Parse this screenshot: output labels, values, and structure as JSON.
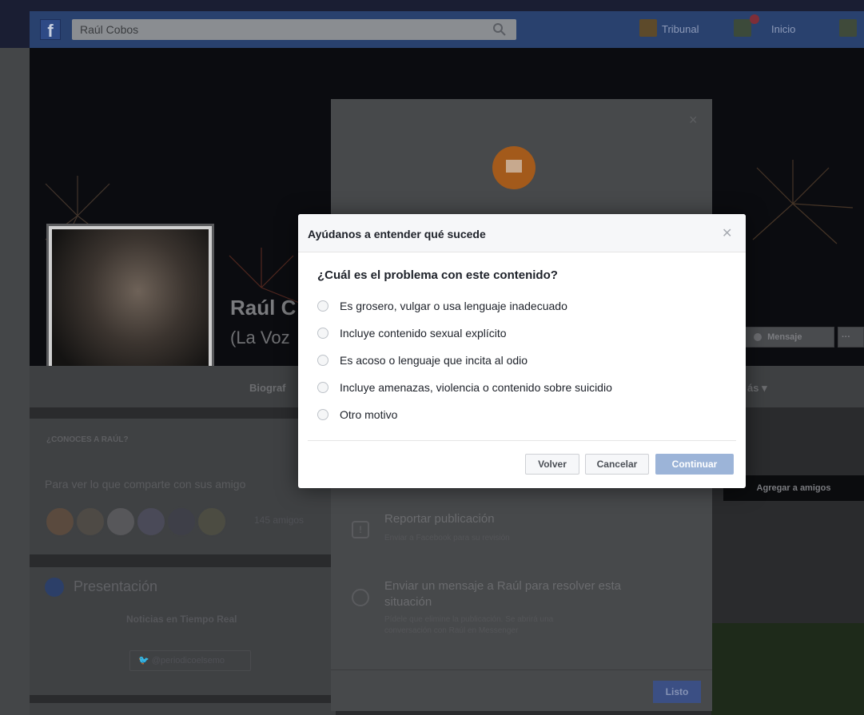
{
  "topbar": {
    "search_value": "Raúl Cobos",
    "nav": [
      {
        "label": "Tribunal"
      },
      {
        "label": "Inicio"
      }
    ]
  },
  "profile": {
    "name": "Raúl C",
    "subtitle": "(La Voz",
    "tab_biography": "Biograf",
    "tab_more": "ás ▾",
    "message_button": "Mensaje",
    "more_button": "···"
  },
  "sidebar": {
    "know_label": "¿CONOCES A RAÚL?",
    "know_text": "Para ver lo que comparte con sus amigo",
    "friends_count": "145 amigos",
    "add_friend": "Agregar a amigos",
    "intro_title": "Presentación",
    "intro_text": "Noticias en Tiempo Real",
    "twitter_handle": "@periodicoelsemo"
  },
  "report_dialog": {
    "option1_title": "Reportar publicación",
    "option1_desc": "Enviar a Facebook para su revisión",
    "option2_title": "Enviar un mensaje a Raúl para resolver esta",
    "option2_title_line2": "situación",
    "option2_desc": "Pídele que elimine la publicación. Se abrirá una",
    "option2_desc_line2": "conversación con Raúl en Messenger",
    "done_button": "Listo"
  },
  "modal": {
    "title": "Ayúdanos a entender qué sucede",
    "question": "¿Cuál es el problema con este contenido?",
    "options": [
      {
        "label": "Es grosero, vulgar o usa lenguaje inadecuado"
      },
      {
        "label": "Incluye contenido sexual explícito"
      },
      {
        "label": "Es acoso o lenguaje que incita al odio"
      },
      {
        "label": "Incluye amenazas, violencia o contenido sobre suicidio"
      },
      {
        "label": "Otro motivo"
      }
    ],
    "back_button": "Volver",
    "cancel_button": "Cancelar",
    "continue_button": "Continuar"
  },
  "colors": {
    "facebook_blue": "#3b5998",
    "primary_disabled": "#9cb4d8",
    "report_orange": "#e07d26"
  }
}
